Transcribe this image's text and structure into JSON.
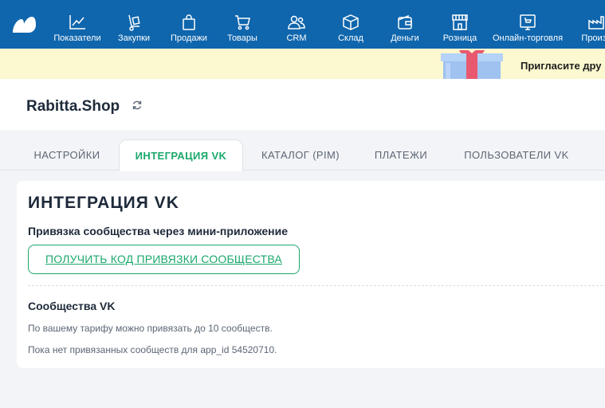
{
  "nav": {
    "items": [
      {
        "label": "Показатели",
        "icon": "chart-line-icon"
      },
      {
        "label": "Закупки",
        "icon": "hand-truck-icon"
      },
      {
        "label": "Продажи",
        "icon": "shopping-bag-icon"
      },
      {
        "label": "Товары",
        "icon": "cart-icon"
      },
      {
        "label": "CRM",
        "icon": "users-icon"
      },
      {
        "label": "Склад",
        "icon": "box-icon"
      },
      {
        "label": "Деньги",
        "icon": "wallet-icon"
      },
      {
        "label": "Розница",
        "icon": "store-icon"
      },
      {
        "label": "Онлайн-торговля",
        "icon": "online-shop-icon"
      },
      {
        "label": "Произв",
        "icon": "production-icon"
      }
    ]
  },
  "promo": {
    "text": "Пригласите дру"
  },
  "header": {
    "title": "Rabitta.Shop"
  },
  "tabs": [
    {
      "label": "НАСТРОЙКИ"
    },
    {
      "label": "ИНТЕГРАЦИЯ VK"
    },
    {
      "label": "КАТАЛОГ (PIM)"
    },
    {
      "label": "ПЛАТЕЖИ"
    },
    {
      "label": "ПОЛЬЗОВАТЕЛИ VK"
    }
  ],
  "active_tab": "ИНТЕГРАЦИЯ VK",
  "card": {
    "title": "ИНТЕГРАЦИЯ VK",
    "binding_heading": "Привязка сообщества через мини-приложение",
    "get_code_button": "ПОЛУЧИТЬ КОД ПРИВЯЗКИ СООБЩЕСТВА",
    "communities_heading": "Сообщества VK",
    "tariff_note": "По вашему тарифу можно привязать до 10 сообществ.",
    "empty_note": "Пока нет привязанных сообществ для app_id 54520710."
  },
  "colors": {
    "nav_bg": "#0f66ad",
    "promo_bg": "#fcf8cf",
    "accent_green": "#1ba86b",
    "page_bg": "#f3f4f7"
  }
}
